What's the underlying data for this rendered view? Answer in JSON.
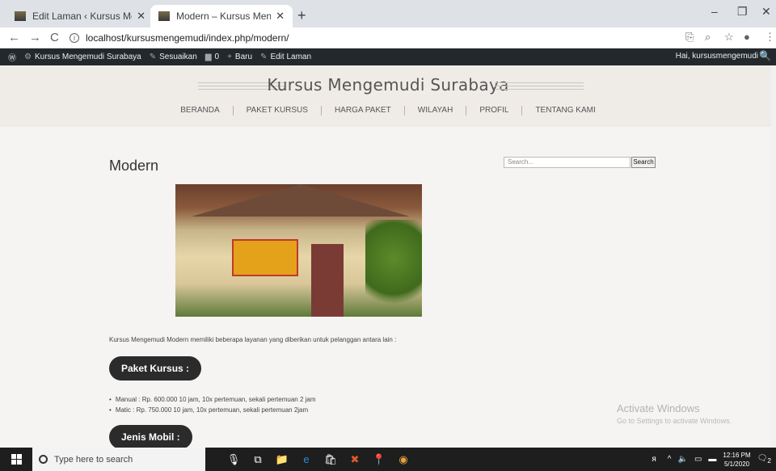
{
  "browser": {
    "tabs": [
      {
        "title": "Edit Laman ‹ Kursus Mengemudi",
        "close": "✕"
      },
      {
        "title": "Modern – Kursus Mengemudi Su",
        "close": "✕"
      }
    ],
    "new_tab": "+",
    "window_controls": [
      "–",
      "❐",
      "✕"
    ],
    "url": "localhost/kursusmengemudi/index.php/modern/",
    "nav": {
      "back": "←",
      "forward": "→",
      "reload": "C"
    }
  },
  "adminbar": {
    "items": [
      {
        "label": "Kursus Mengemudi Surabaya",
        "icon": "⚙"
      },
      {
        "label": "Sesuaikan",
        "icon": "✎"
      },
      {
        "label": "0",
        "icon": "▆"
      },
      {
        "label": "Baru",
        "icon": "+"
      },
      {
        "label": "Edit Laman",
        "icon": "✎"
      }
    ],
    "greeting": "Hai, kursusmengemudi",
    "search_icon": "🔍"
  },
  "header": {
    "site_title": "Kursus Mengemudi Surabaya",
    "menu": [
      "BERANDA",
      "PAKET KURSUS",
      "HARGA PAKET",
      "WILAYAH",
      "PROFIL",
      "TENTANG KAMI"
    ]
  },
  "page": {
    "title": "Modern",
    "lead": "Kursus Mengemudi Modern memiliki beberapa layanan yang diberikan untuk pelanggan antara lain :",
    "section1": "Paket Kursus :",
    "packages": [
      "Manual : Rp. 600.000 10 jam, 10x pertemuan, sekali pertemuan 2 jam",
      "Matic : Rp. 750.000 10 jam, 10x pertemuan, sekali pertemuan 2jam"
    ],
    "section2": "Jenis Mobil :"
  },
  "sidebar": {
    "search_placeholder": "Search...",
    "search_button": "Search"
  },
  "watermark": {
    "line1": "Activate Windows",
    "line2": "Go to Settings to activate Windows."
  },
  "taskbar": {
    "search_placeholder": "Type here to search",
    "time": "12:16 PM",
    "date": "5/1/2020",
    "notification_count": "2"
  }
}
